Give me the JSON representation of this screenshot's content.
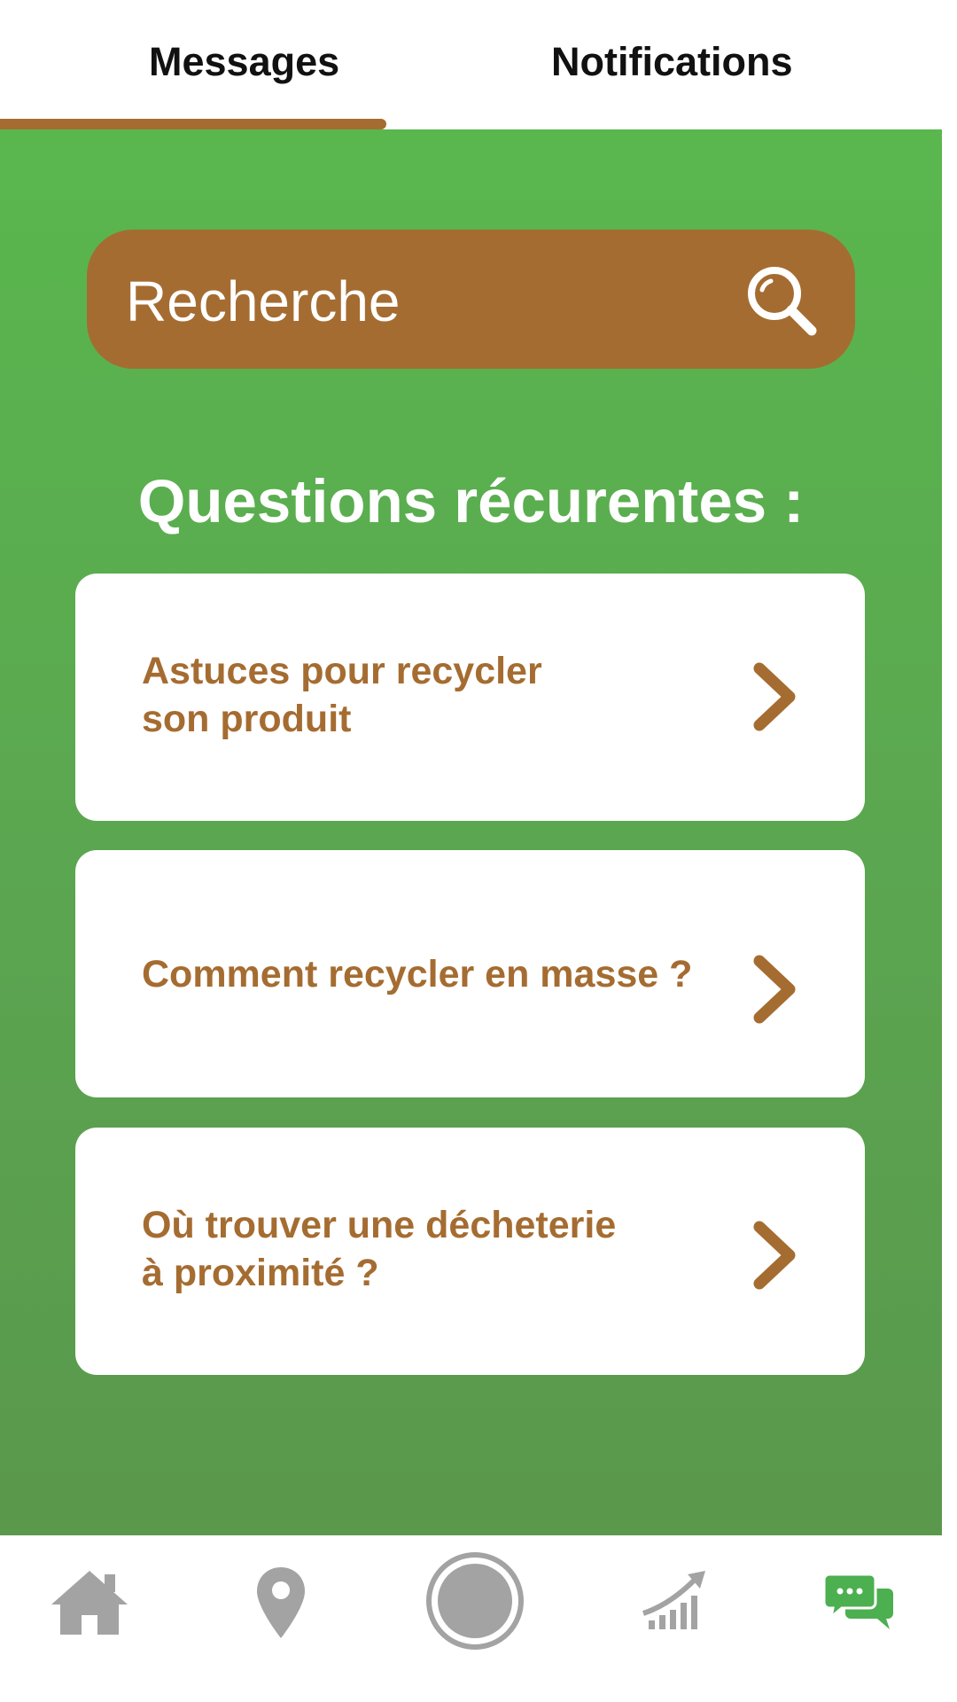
{
  "tabs": [
    {
      "label": "Messages",
      "active": true
    },
    {
      "label": "Notifications",
      "active": false
    }
  ],
  "search": {
    "placeholder": "Recherche",
    "icon": "search-icon"
  },
  "section_title": "Questions récurentes :",
  "questions": [
    {
      "line1": "Astuces pour recycler",
      "line2": "son produit"
    },
    {
      "line1": "Comment recycler en masse ?",
      "line2": ""
    },
    {
      "line1": "Où trouver une décheterie",
      "line2": "à proximité ?"
    }
  ],
  "bottom_nav": [
    {
      "icon": "home-icon",
      "active": false
    },
    {
      "icon": "location-pin-icon",
      "active": false
    },
    {
      "icon": "camera-capture-icon",
      "active": false
    },
    {
      "icon": "growth-chart-icon",
      "active": false
    },
    {
      "icon": "chat-icon",
      "active": true
    }
  ],
  "colors": {
    "accent_brown": "#a56c31",
    "green": "#5ab74e",
    "nav_inactive": "#a3a3a3",
    "nav_active": "#4caf50"
  }
}
